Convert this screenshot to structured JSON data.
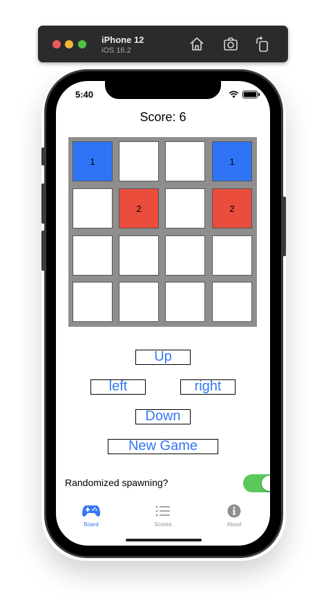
{
  "simulator": {
    "device_name": "iPhone 12",
    "os_version": "iOS 16.2",
    "toolbar_icons": [
      "home-icon",
      "screenshot-icon",
      "rotate-icon"
    ]
  },
  "status_bar": {
    "time": "5:40",
    "signal_dots": "....",
    "icons": [
      "wifi-icon",
      "battery-icon"
    ]
  },
  "game": {
    "score_label": "Score: 6",
    "board": [
      [
        {
          "value": "1",
          "color": "#2f74f5"
        },
        {
          "value": "",
          "color": "#ffffff"
        },
        {
          "value": "",
          "color": "#ffffff"
        },
        {
          "value": "1",
          "color": "#2f74f5"
        }
      ],
      [
        {
          "value": "",
          "color": "#ffffff"
        },
        {
          "value": "2",
          "color": "#ea4d3c"
        },
        {
          "value": "",
          "color": "#ffffff"
        },
        {
          "value": "2",
          "color": "#ea4d3c"
        }
      ],
      [
        {
          "value": "",
          "color": "#ffffff"
        },
        {
          "value": "",
          "color": "#ffffff"
        },
        {
          "value": "",
          "color": "#ffffff"
        },
        {
          "value": "",
          "color": "#ffffff"
        }
      ],
      [
        {
          "value": "",
          "color": "#ffffff"
        },
        {
          "value": "",
          "color": "#ffffff"
        },
        {
          "value": "",
          "color": "#ffffff"
        },
        {
          "value": "",
          "color": "#ffffff"
        }
      ]
    ]
  },
  "controls": {
    "up": "Up",
    "left": "left",
    "right": "right",
    "down": "Down",
    "new_game": "New Game"
  },
  "settings": {
    "randomized_label": "Randomized spawning?",
    "randomized_on": true
  },
  "tabbar": {
    "accent_color": "#3478f6",
    "inactive_color": "#8e8e93",
    "tabs": [
      {
        "label": "Board",
        "icon": "gamecontroller-icon",
        "active": true
      },
      {
        "label": "Scores",
        "icon": "list-icon",
        "active": false
      },
      {
        "label": "About",
        "icon": "info-icon",
        "active": false
      }
    ]
  }
}
